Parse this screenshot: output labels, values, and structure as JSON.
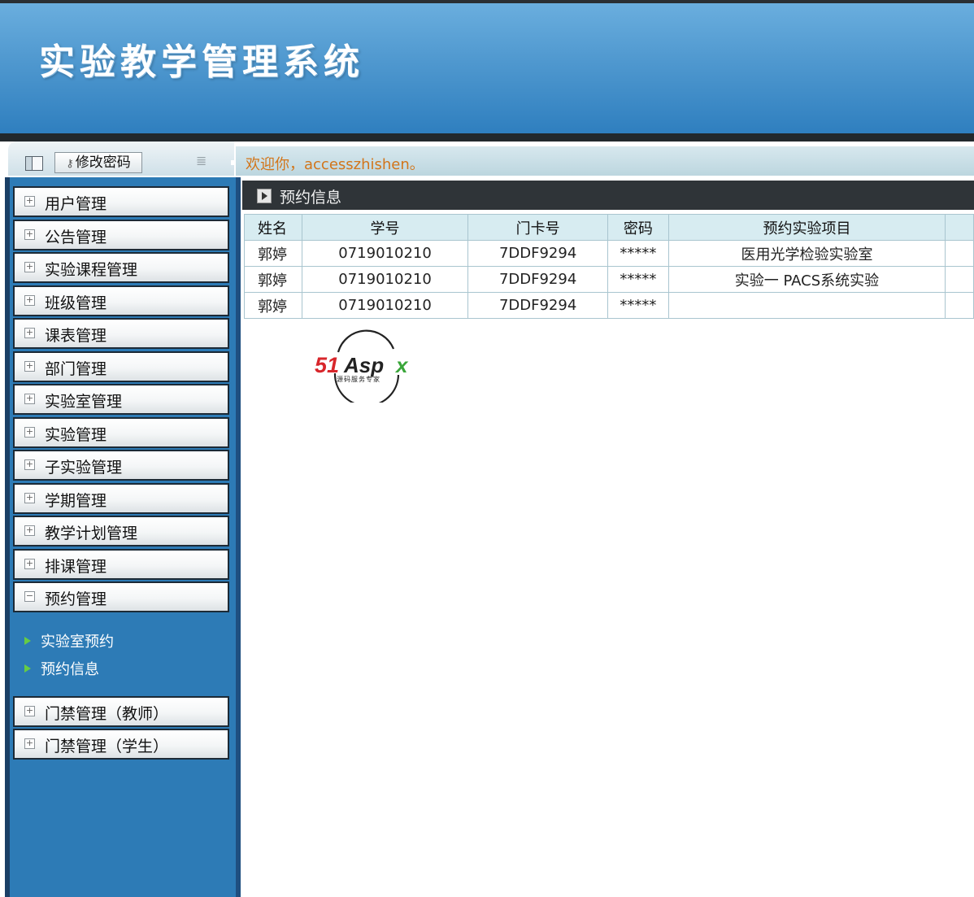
{
  "header": {
    "title": "实验教学管理系统"
  },
  "toolbar": {
    "change_password_label": "修改密码",
    "welcome_text": "欢迎你，accesszhishen。"
  },
  "sidebar": {
    "menu": [
      {
        "label": "用户管理",
        "expanded": false
      },
      {
        "label": "公告管理",
        "expanded": false
      },
      {
        "label": "实验课程管理",
        "expanded": false
      },
      {
        "label": "班级管理",
        "expanded": false
      },
      {
        "label": "课表管理",
        "expanded": false
      },
      {
        "label": "部门管理",
        "expanded": false
      },
      {
        "label": "实验室管理",
        "expanded": false
      },
      {
        "label": "实验管理",
        "expanded": false
      },
      {
        "label": "子实验管理",
        "expanded": false
      },
      {
        "label": "学期管理",
        "expanded": false
      },
      {
        "label": "教学计划管理",
        "expanded": false
      },
      {
        "label": "排课管理",
        "expanded": false
      },
      {
        "label": "预约管理",
        "expanded": true
      }
    ],
    "submenu": [
      {
        "label": "实验室预约"
      },
      {
        "label": "预约信息"
      }
    ],
    "menu_after": [
      {
        "label": "门禁管理（教师）",
        "expanded": false
      },
      {
        "label": "门禁管理（学生）",
        "expanded": false
      }
    ]
  },
  "content": {
    "title": "预约信息",
    "table": {
      "columns": [
        "姓名",
        "学号",
        "门卡号",
        "密码",
        "预约实验项目"
      ],
      "rows": [
        [
          "郭婷",
          "0719010210",
          "7DDF9294",
          "*****",
          "医用光学检验实验室"
        ],
        [
          "郭婷",
          "0719010210",
          "7DDF9294",
          "*****",
          "实验一 PACS系统实验"
        ],
        [
          "郭婷",
          "0719010210",
          "7DDF9294",
          "*****",
          ""
        ]
      ]
    }
  },
  "watermark": {
    "brand": "51Aspx",
    "tagline": "源码服务专家"
  },
  "colors": {
    "header_blue": "#4f98cf",
    "sidebar_blue": "#2d7bb6",
    "welcome_orange": "#d2751a",
    "table_header": "#d7ecf1",
    "content_bar": "#2f3438"
  }
}
